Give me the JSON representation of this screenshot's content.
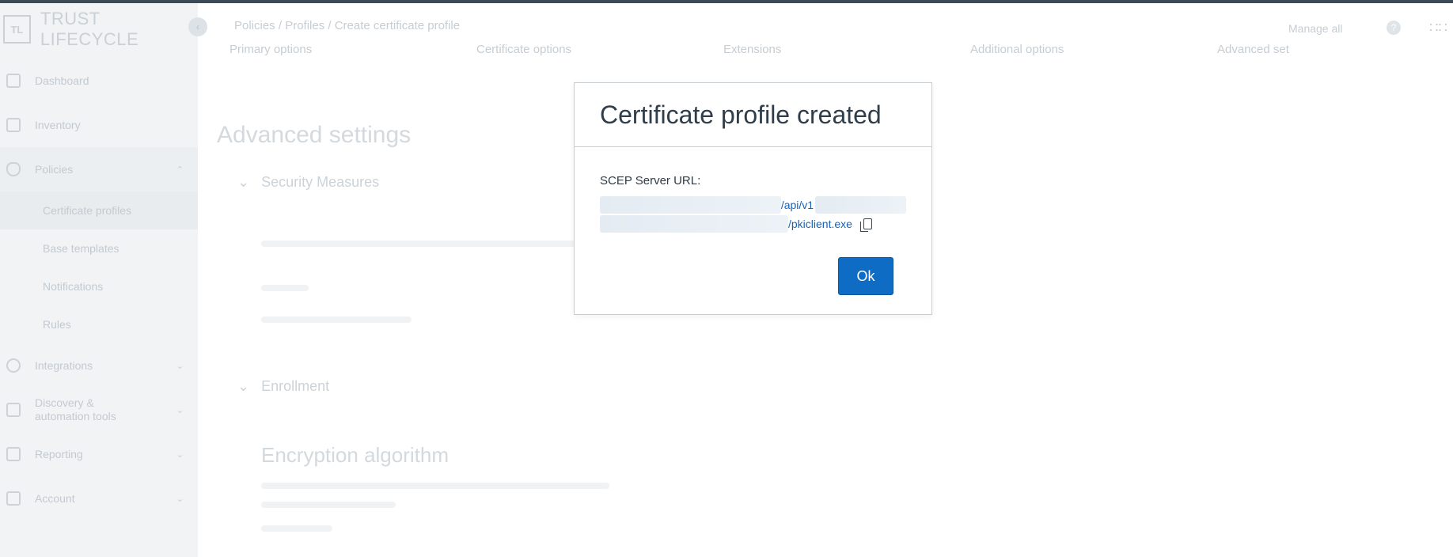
{
  "app": {
    "brand_mark": "TL",
    "brand_name": "TRUST LIFECYCLE"
  },
  "sidebar": {
    "items": [
      {
        "label": "Dashboard"
      },
      {
        "label": "Inventory"
      },
      {
        "label": "Policies"
      },
      {
        "label": "Integrations"
      },
      {
        "label": "Discovery & automation tools"
      },
      {
        "label": "Reporting"
      },
      {
        "label": "Account"
      }
    ],
    "policies_sub": [
      {
        "label": "Certificate profiles"
      },
      {
        "label": "Base templates"
      },
      {
        "label": "Notifications"
      },
      {
        "label": "Rules"
      }
    ]
  },
  "header": {
    "breadcrumb": "Policies / Profiles / Create certificate profile",
    "manage_all": "Manage all"
  },
  "main": {
    "tabs": [
      "Primary options",
      "Certificate options",
      "Extensions",
      "Additional options",
      "Advanced set"
    ],
    "section_title": "Advanced settings",
    "group1": "Security Measures",
    "group2": "Enrollment",
    "subhead": "Encryption algorithm"
  },
  "modal": {
    "title": "Certificate profile created",
    "field_label": "SCEP Server URL:",
    "url_line1_suffix": "/api/v1",
    "url_line2_suffix": "/pkiclient.exe",
    "ok_label": "Ok"
  }
}
